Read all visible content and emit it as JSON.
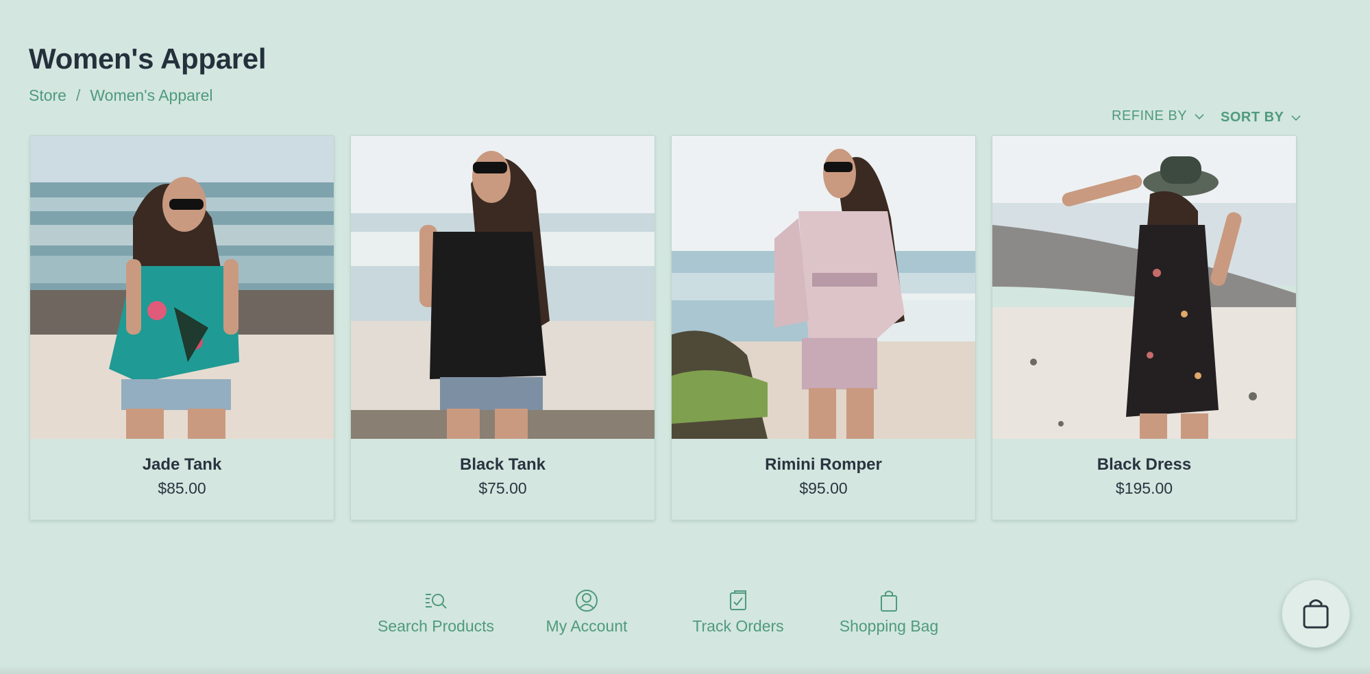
{
  "header": {
    "title": "Women's Apparel",
    "breadcrumb": [
      "Store",
      "/",
      "Women's Apparel"
    ]
  },
  "filters": {
    "refine_label": "REFINE BY",
    "sort_label": "SORT BY"
  },
  "products": [
    {
      "name": "Jade Tank",
      "price": "$85.00"
    },
    {
      "name": "Black Tank",
      "price": "$75.00"
    },
    {
      "name": "Rimini Romper",
      "price": "$95.00"
    },
    {
      "name": "Black Dress",
      "price": "$195.00"
    }
  ],
  "bottom_nav": [
    {
      "label": "Search Products",
      "icon": "search-products-icon"
    },
    {
      "label": "My Account",
      "icon": "account-icon"
    },
    {
      "label": "Track Orders",
      "icon": "track-orders-icon"
    },
    {
      "label": "Shopping Bag",
      "icon": "shopping-bag-icon"
    }
  ],
  "colors": {
    "background": "#d3e6df",
    "accent": "#4f9a7e",
    "text": "#24313c"
  }
}
